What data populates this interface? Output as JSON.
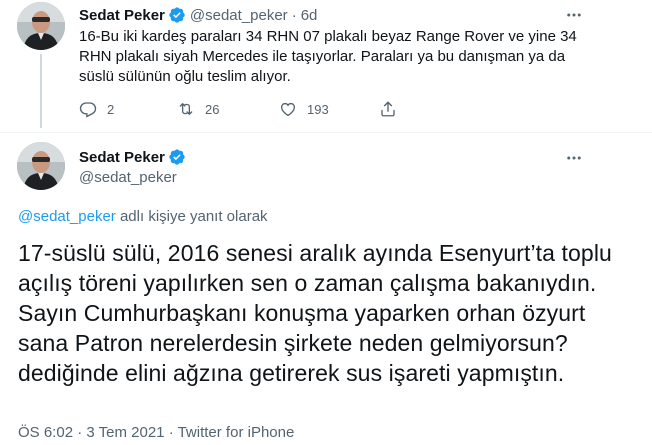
{
  "tweet1": {
    "author_name": "Sedat Peker",
    "handle": "@sedat_peker",
    "separator": "·",
    "time": "6d",
    "text": "16-Bu iki kardeş paraları 34 RHN 07 plakalı beyaz Range Rover ve yine 34 RHN plakalı siyah Mercedes ile taşıyorlar. Paraları ya bu danışman ya da süslü sülünün oğlu teslim alıyor.",
    "replies": "2",
    "retweets": "26",
    "likes": "193",
    "icons": {
      "more": "more-dots-icon",
      "reply": "reply-icon",
      "retweet": "retweet-icon",
      "like": "heart-icon",
      "share": "share-icon",
      "verified": "verified-badge-icon"
    }
  },
  "tweet2": {
    "author_name": "Sedat Peker",
    "handle": "@sedat_peker",
    "replying_handle": "@sedat_peker",
    "replying_suffix": " adlı kişiye yanıt olarak",
    "text": "17-süslü sülü, 2016 senesi aralık ayında Esenyurt’ta toplu açılış töreni yapılırken sen o zaman çalışma bakanıydın. Sayın Cumhurbaşkanı konuşma yaparken orhan özyurt sana Patron nerelerdesin şirkete neden gelmiyorsun? dediğinde elini ağzına getirerek sus işareti yapmıştın.",
    "time": "ÖS 6:02",
    "date": "3 Tem 2021",
    "source": "Twitter for iPhone",
    "separator": "·"
  },
  "colors": {
    "accent": "#1d9bf0",
    "secondary_text": "#536471",
    "primary_text": "#0f1419",
    "divider": "#eff3f4",
    "thread_line": "#cfd9de"
  }
}
